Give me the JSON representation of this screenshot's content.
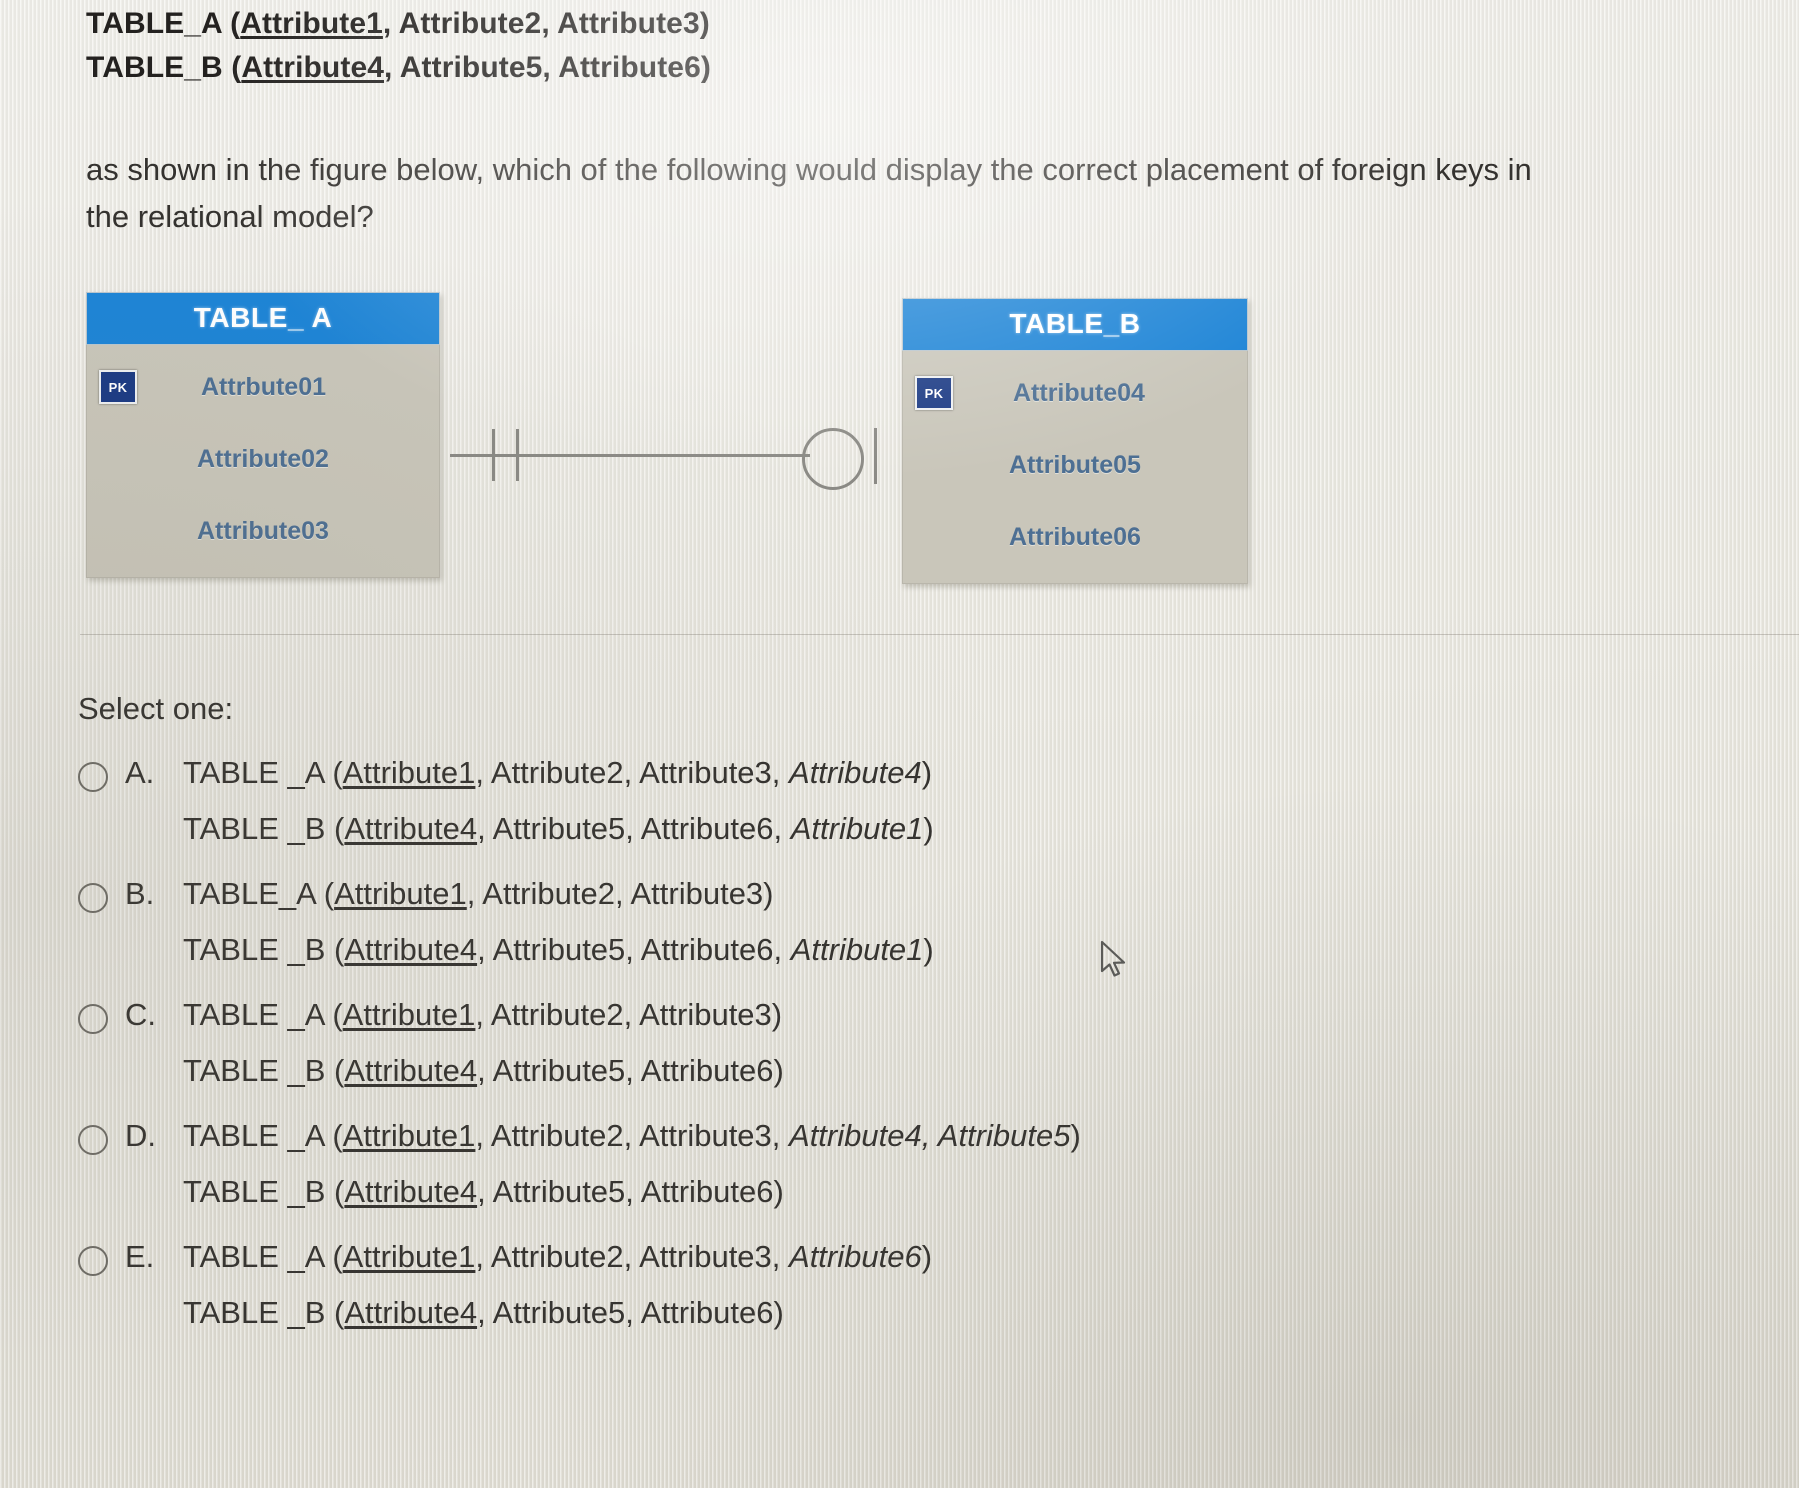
{
  "header": {
    "lines": [
      {
        "table": "TABLE_A (",
        "pk": "Attribute1",
        "rest": ", Attribute2, Attribute3)"
      },
      {
        "table": "TABLE_B (",
        "pk": "Attribute4",
        "rest": ", Attribute5, Attribute6)"
      }
    ]
  },
  "prompt": {
    "text": "as shown in the figure below, which of the following would display the correct placement of foreign keys in the relational model?"
  },
  "diagram": {
    "accent_color": "#1d84d6",
    "body_color": "#c9c6ba",
    "attr_text_color": "#4d6f93",
    "pk_badge_label": "PK",
    "entities": [
      {
        "title": "TABLE_ A",
        "attributes": [
          {
            "name": "Attrbute01",
            "pk": true
          },
          {
            "name": "Attribute02",
            "pk": false
          },
          {
            "name": "Attribute03",
            "pk": false
          }
        ]
      },
      {
        "title": "TABLE_B",
        "attributes": [
          {
            "name": "Attribute04",
            "pk": true
          },
          {
            "name": "Attribute05",
            "pk": false
          },
          {
            "name": "Attribute06",
            "pk": false
          }
        ]
      }
    ],
    "relationship": {
      "left_notation": "one-and-only-one",
      "right_notation": "zero-or-one"
    }
  },
  "answers": {
    "select_label": "Select one:",
    "options": [
      {
        "letter": "A.",
        "selected": false,
        "lines": [
          {
            "pre": "TABLE _A (",
            "pk": "Attribute1",
            "mid": ", Attribute2, Attribute3, ",
            "fk": "Attribute4",
            "post": ")"
          },
          {
            "pre": "TABLE _B (",
            "pk": "Attribute4",
            "mid": ", Attribute5, Attribute6, ",
            "fk": "Attribute1",
            "post": ")"
          }
        ]
      },
      {
        "letter": "B.",
        "selected": false,
        "lines": [
          {
            "pre": "TABLE_A (",
            "pk": "Attribute1",
            "mid": ", Attribute2, Attribute3)",
            "fk": "",
            "post": ""
          },
          {
            "pre": "TABLE _B (",
            "pk": "Attribute4",
            "mid": ", Attribute5, Attribute6, ",
            "fk": "Attribute1",
            "post": ")"
          }
        ]
      },
      {
        "letter": "C.",
        "selected": false,
        "lines": [
          {
            "pre": "TABLE _A (",
            "pk": "Attribute1",
            "mid": ", Attribute2, Attribute3)",
            "fk": "",
            "post": ""
          },
          {
            "pre": "TABLE _B (",
            "pk": "Attribute4",
            "mid": ", Attribute5, Attribute6)",
            "fk": "",
            "post": ""
          }
        ]
      },
      {
        "letter": "D.",
        "selected": false,
        "lines": [
          {
            "pre": "TABLE _A (",
            "pk": "Attribute1",
            "mid": ", Attribute2, Attribute3, ",
            "fk": "Attribute4, Attribute5",
            "post": ")"
          },
          {
            "pre": "TABLE _B (",
            "pk": "Attribute4",
            "mid": ", Attribute5, Attribute6)",
            "fk": "",
            "post": ""
          }
        ]
      },
      {
        "letter": "E.",
        "selected": false,
        "lines": [
          {
            "pre": "TABLE _A (",
            "pk": "Attribute1",
            "mid": ", Attribute2, Attribute3, ",
            "fk": "Attribute6",
            "post": ")"
          },
          {
            "pre": "TABLE _B (",
            "pk": "Attribute4",
            "mid": ", Attribute5, Attribute6)",
            "fk": "",
            "post": ""
          }
        ]
      }
    ]
  },
  "cursor": {
    "type": "arrow-pointer"
  }
}
